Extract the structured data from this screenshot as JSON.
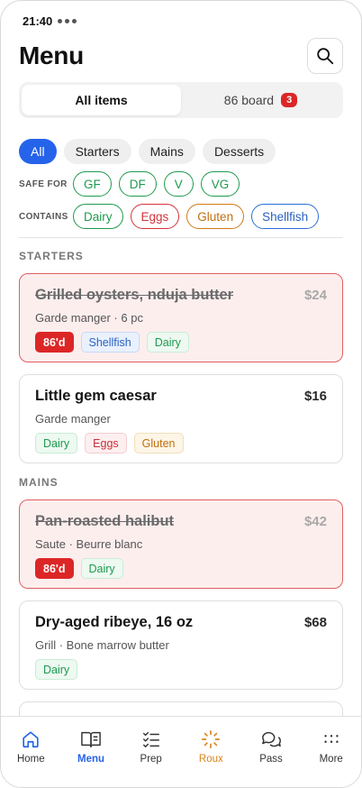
{
  "status": {
    "time": "21:40"
  },
  "header": {
    "title": "Menu",
    "search_icon": "search-icon"
  },
  "segments": [
    {
      "label": "All items",
      "active": true
    },
    {
      "label": "86 board",
      "badge": "3",
      "active": false
    }
  ],
  "categories": [
    "All",
    "Starters",
    "Mains",
    "Desserts"
  ],
  "safe_for": {
    "label": "SAFE FOR",
    "chips": [
      "GF",
      "DF",
      "V",
      "VG"
    ]
  },
  "contains": {
    "label": "CONTAINS",
    "chips": [
      "Dairy",
      "Eggs",
      "Gluten",
      "Shellfish"
    ]
  },
  "sections": {
    "starters": "STARTERS",
    "mains": "MAINS"
  },
  "items": [
    {
      "name": "Grilled oysters, nduja butter",
      "price": "$24",
      "sub": "Garde manger · 6 pc",
      "sold_out": true,
      "tags": [
        "86'd",
        "Shellfish",
        "Dairy"
      ]
    },
    {
      "name": "Little gem caesar",
      "price": "$16",
      "sub": "Garde manger",
      "sold_out": false,
      "tags": [
        "Dairy",
        "Eggs",
        "Gluten"
      ]
    },
    {
      "name": "Pan-roasted halibut",
      "price": "$42",
      "sub": "Saute · Beurre blanc",
      "sold_out": true,
      "tags": [
        "86'd",
        "Dairy"
      ]
    },
    {
      "name": "Dry-aged ribeye, 16 oz",
      "price": "$68",
      "sub": "Grill · Bone marrow butter",
      "sold_out": false,
      "tags": [
        "Dairy"
      ]
    }
  ],
  "tabs": [
    {
      "label": "Home",
      "icon": "home-icon"
    },
    {
      "label": "Menu",
      "icon": "book-icon",
      "active": true
    },
    {
      "label": "Prep",
      "icon": "checklist-icon"
    },
    {
      "label": "Roux",
      "icon": "sparkle-icon"
    },
    {
      "label": "Pass",
      "icon": "chat-icon"
    },
    {
      "label": "More",
      "icon": "dots-grid-icon"
    }
  ],
  "colors": {
    "accent": "#2563eb",
    "sold_out": "#dc2626",
    "roux": "#d9861a"
  }
}
